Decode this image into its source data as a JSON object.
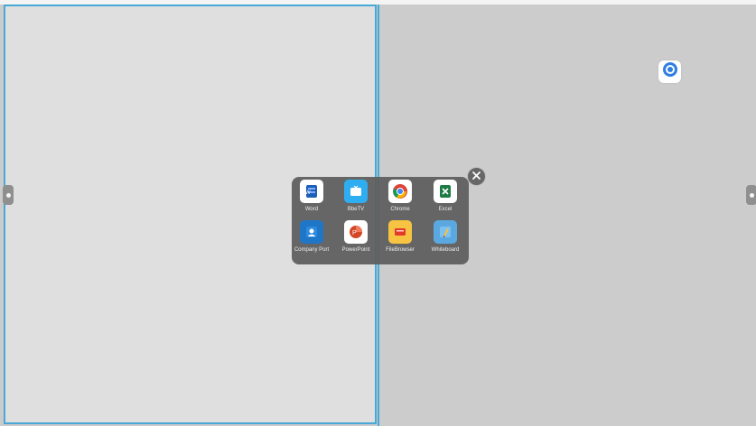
{
  "screen": {
    "title": ""
  },
  "launcher": {
    "close_icon": "close-icon",
    "apps": [
      {
        "label": "Word",
        "icon": "word-icon"
      },
      {
        "label": "BbeTV",
        "icon": "tv-icon"
      },
      {
        "label": "Chrome",
        "icon": "chrome-icon"
      },
      {
        "label": "Excel",
        "icon": "excel-icon"
      },
      {
        "label": "Company Port",
        "icon": "company-portal-icon"
      },
      {
        "label": "PowerPoint",
        "icon": "powerpoint-icon"
      },
      {
        "label": "FileBrowser",
        "icon": "folder-icon"
      },
      {
        "label": "Whiteboard",
        "icon": "whiteboard-icon"
      }
    ]
  },
  "floating_app": {
    "icon": "circle-app-icon"
  },
  "colors": {
    "accent": "#48a9d8",
    "launcher_bg": "#5f5f5f",
    "left_pane_bg": "#dfdfdf",
    "right_pane_bg": "#cccccc"
  }
}
